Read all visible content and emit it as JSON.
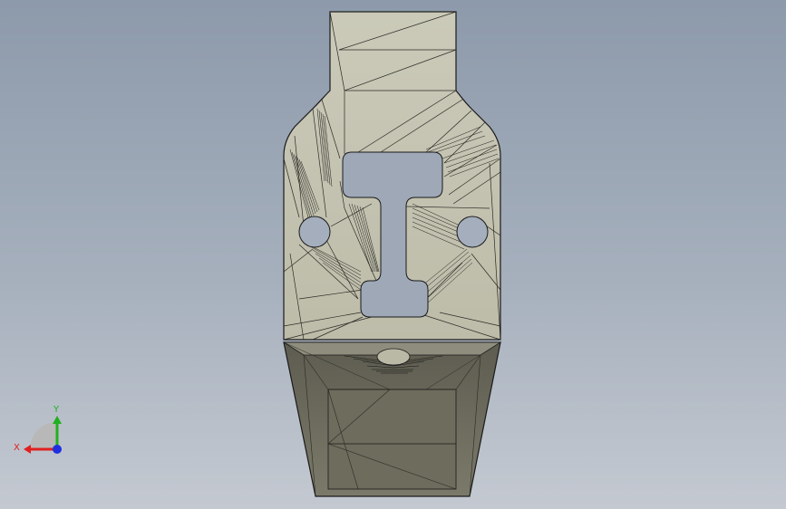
{
  "viewport": {
    "background_top": "#8d9aab",
    "background_bottom": "#c4c9d1",
    "part_face_color": "#c8c7b5",
    "part_shadow_color": "#6f6e60",
    "edge_color": "#1a1a1a"
  },
  "triad": {
    "x_label": "X",
    "y_label": "Y",
    "x_color": "#e02020",
    "y_color": "#20b020",
    "z_color": "#2030e0"
  }
}
